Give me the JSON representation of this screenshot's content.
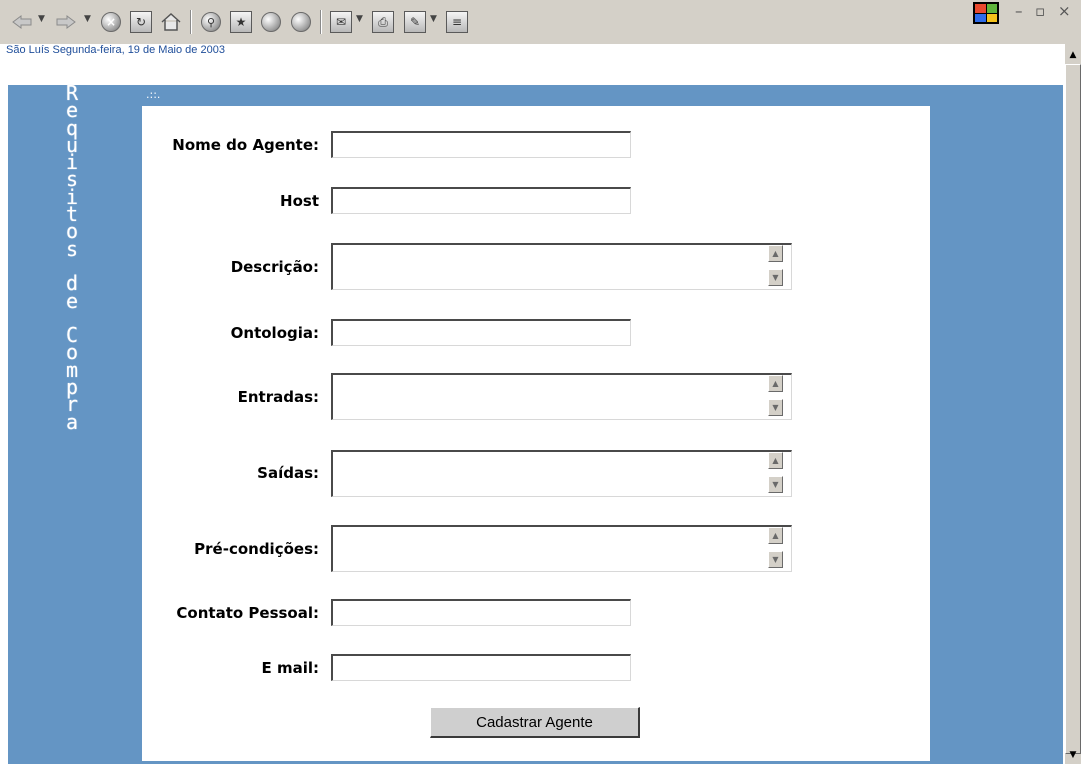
{
  "toolbar": {
    "icons": [
      "back-icon",
      "forward-icon",
      "stop-icon",
      "refresh-icon",
      "home-icon",
      "search-icon",
      "favorites-icon",
      "history-icon",
      "channels-icon",
      "mail-icon",
      "print-icon",
      "edit-icon",
      "discuss-icon"
    ],
    "window_min": "–",
    "window_max": "▫",
    "window_close": "×"
  },
  "dateline": "São Luís Segunda-feira, 19 de Maio de 2003",
  "sidebar_title_letters": [
    "R",
    "e",
    "q",
    "u",
    "i",
    "s",
    "i",
    "t",
    "o",
    "s",
    " ",
    "d",
    "e",
    " ",
    "C",
    "o",
    "m",
    "p",
    "r",
    "a"
  ],
  "dots": ".::.",
  "form": {
    "fields": [
      {
        "label": "Nome do Agente:",
        "type": "input",
        "value": ""
      },
      {
        "label": "Host",
        "type": "input",
        "value": ""
      },
      {
        "label": "Descrição:",
        "type": "textarea",
        "value": ""
      },
      {
        "label": "Ontologia:",
        "type": "input",
        "value": ""
      },
      {
        "label": "Entradas:",
        "type": "textarea",
        "value": ""
      },
      {
        "label": "Saídas:",
        "type": "textarea",
        "value": ""
      },
      {
        "label": "Pré-condições:",
        "type": "textarea",
        "value": ""
      },
      {
        "label": "Contato Pessoal:",
        "type": "input",
        "value": ""
      },
      {
        "label": "E mail:",
        "type": "input",
        "value": ""
      }
    ],
    "submit_label": "Cadastrar Agente"
  },
  "colors": {
    "page_blue": "#6495c4",
    "dateline": "#1f4e9a"
  }
}
